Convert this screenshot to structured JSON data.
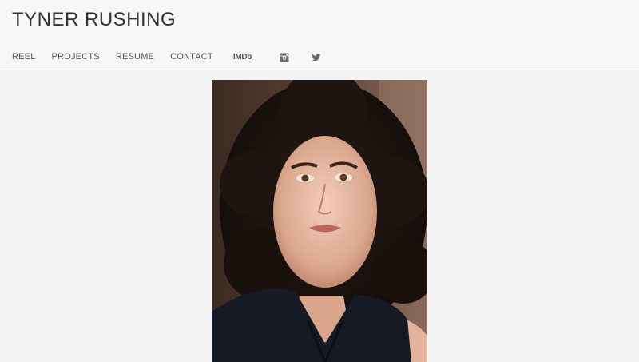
{
  "site": {
    "title": "TYNER RUSHING"
  },
  "nav": {
    "items": [
      {
        "label": "REEL"
      },
      {
        "label": "PROJECTS"
      },
      {
        "label": "RESUME"
      },
      {
        "label": "CONTACT"
      }
    ],
    "imdb_label": "IMDb",
    "social_icons": [
      "instagram-icon",
      "twitter-icon"
    ]
  },
  "colors": {
    "page_background": "#f3f3f3",
    "header_background": "#f7f7f7",
    "title_text": "#333333",
    "nav_text": "#555555"
  }
}
